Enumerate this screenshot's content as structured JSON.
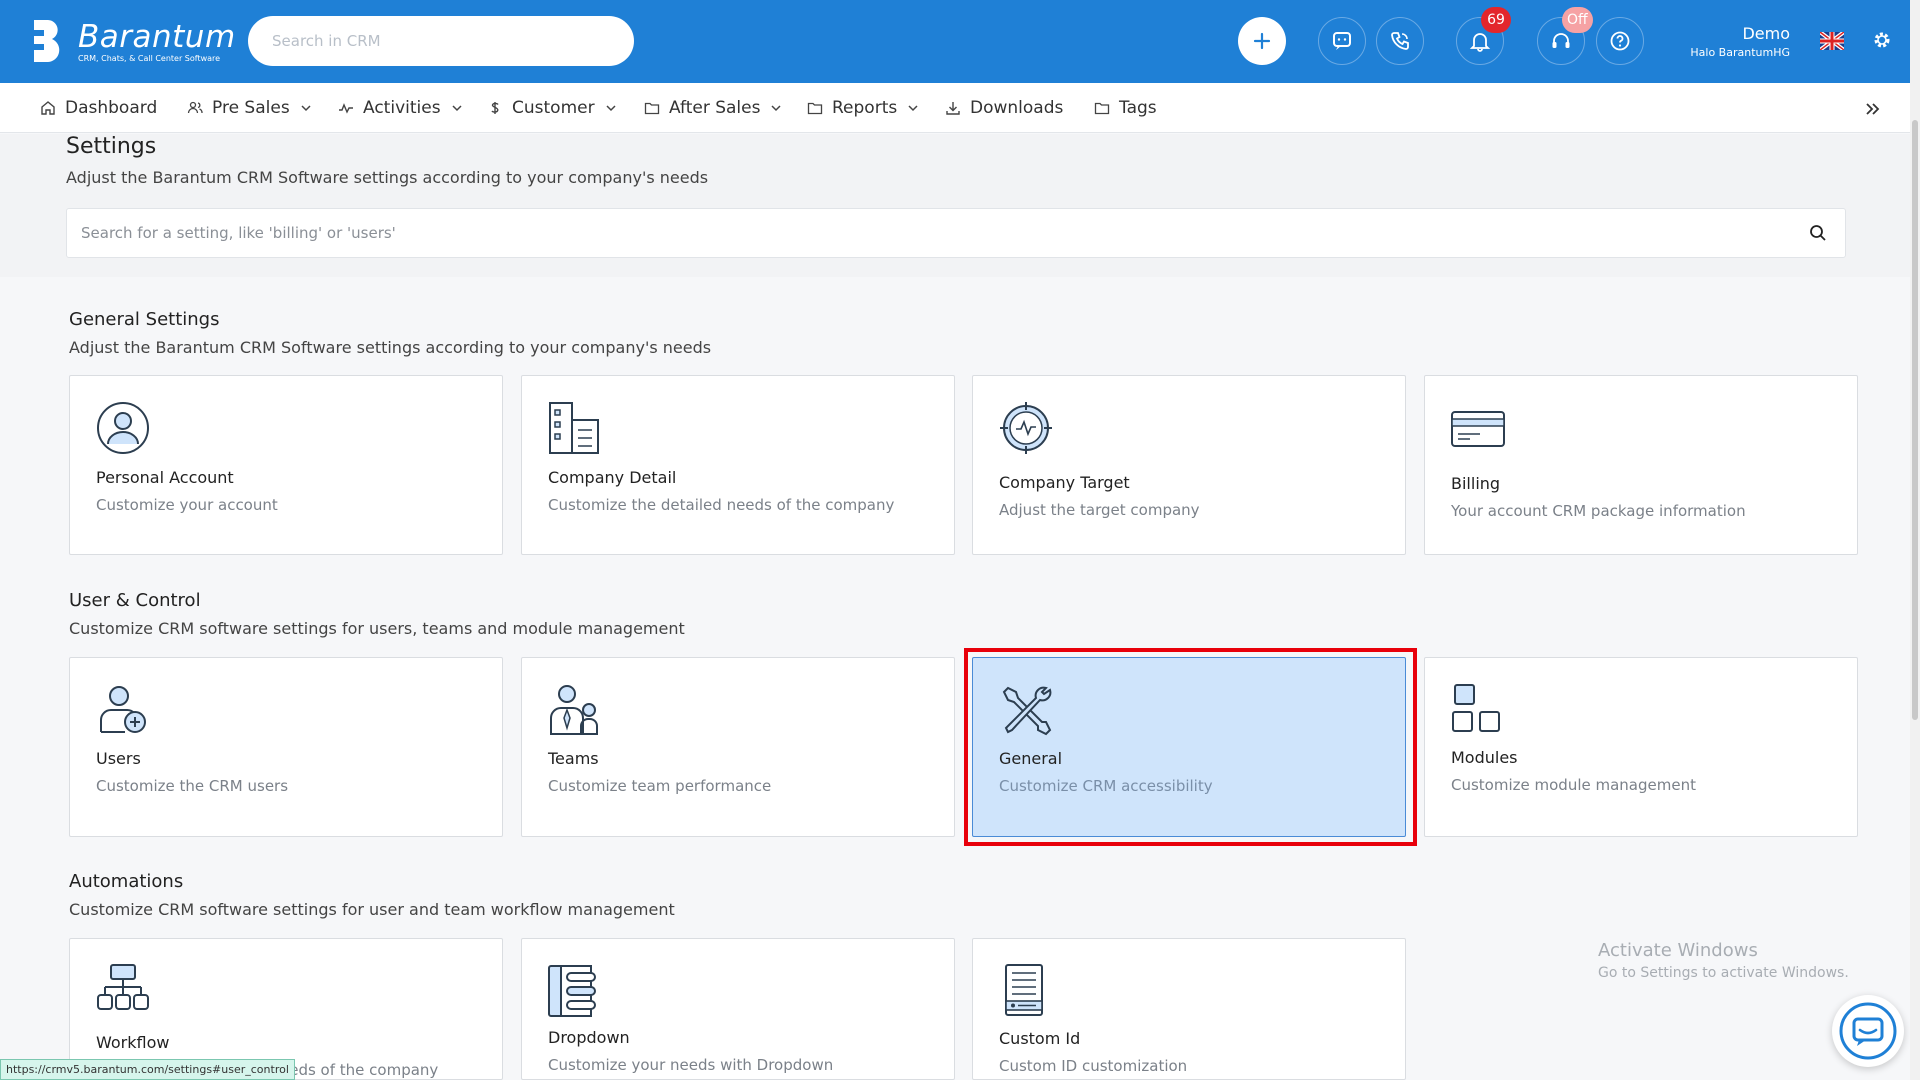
{
  "brand": {
    "name": "Barantum",
    "tagline": "CRM, Chats, & Call Center Software"
  },
  "topbar": {
    "search_placeholder": "Search in CRM",
    "notifications_count": "69",
    "support_status": "Off",
    "user_name": "Demo",
    "user_sub": "Halo BarantumHG"
  },
  "nav": {
    "items": [
      {
        "label": "Dashboard"
      },
      {
        "label": "Pre Sales"
      },
      {
        "label": "Activities"
      },
      {
        "label": "Customer"
      },
      {
        "label": "After Sales"
      },
      {
        "label": "Reports"
      },
      {
        "label": "Downloads"
      },
      {
        "label": "Tags"
      }
    ]
  },
  "page": {
    "title": "Settings",
    "subtitle": "Adjust the Barantum CRM Software settings according to your company's needs",
    "search_placeholder": "Search for a setting, like 'billing' or 'users'"
  },
  "sections": [
    {
      "title": "General Settings",
      "subtitle": "Adjust the Barantum CRM Software settings according to your company's needs",
      "cards": [
        {
          "title": "Personal Account",
          "desc": "Customize your account",
          "icon": "user-circle-icon"
        },
        {
          "title": "Company Detail",
          "desc": "Customize the detailed needs of the company",
          "icon": "building-icon"
        },
        {
          "title": "Company Target",
          "desc": "Adjust the target company",
          "icon": "target-icon"
        },
        {
          "title": "Billing",
          "desc": "Your account CRM package information",
          "icon": "credit-card-icon"
        }
      ]
    },
    {
      "title": "User & Control",
      "subtitle": "Customize CRM software settings for users, teams and module management",
      "cards": [
        {
          "title": "Users",
          "desc": "Customize the CRM users",
          "icon": "user-add-icon"
        },
        {
          "title": "Teams",
          "desc": "Customize team performance",
          "icon": "team-icon"
        },
        {
          "title": "General",
          "desc": "Customize CRM accessibility",
          "icon": "tools-icon"
        },
        {
          "title": "Modules",
          "desc": "Customize module management",
          "icon": "modules-icon"
        }
      ]
    },
    {
      "title": "Automations",
      "subtitle": "Customize CRM software settings for user and team workflow management",
      "cards": [
        {
          "title": "Workflow",
          "desc": "eeds of the company",
          "icon": "workflow-icon"
        },
        {
          "title": "Dropdown",
          "desc": "Customize your needs with Dropdown",
          "icon": "dropdown-icon"
        },
        {
          "title": "Custom Id",
          "desc": "Custom ID customization",
          "icon": "id-card-icon"
        }
      ]
    }
  ],
  "watermark": {
    "line1": "Activate Windows",
    "line2": "Go to Settings to activate Windows."
  },
  "status_url": "https://crmv5.barantum.com/settings#user_control",
  "colors": {
    "primary": "#1f80d6",
    "selected_bg": "#cfe4fb",
    "highlight": "#e8000b",
    "badge": "#e3262c"
  }
}
